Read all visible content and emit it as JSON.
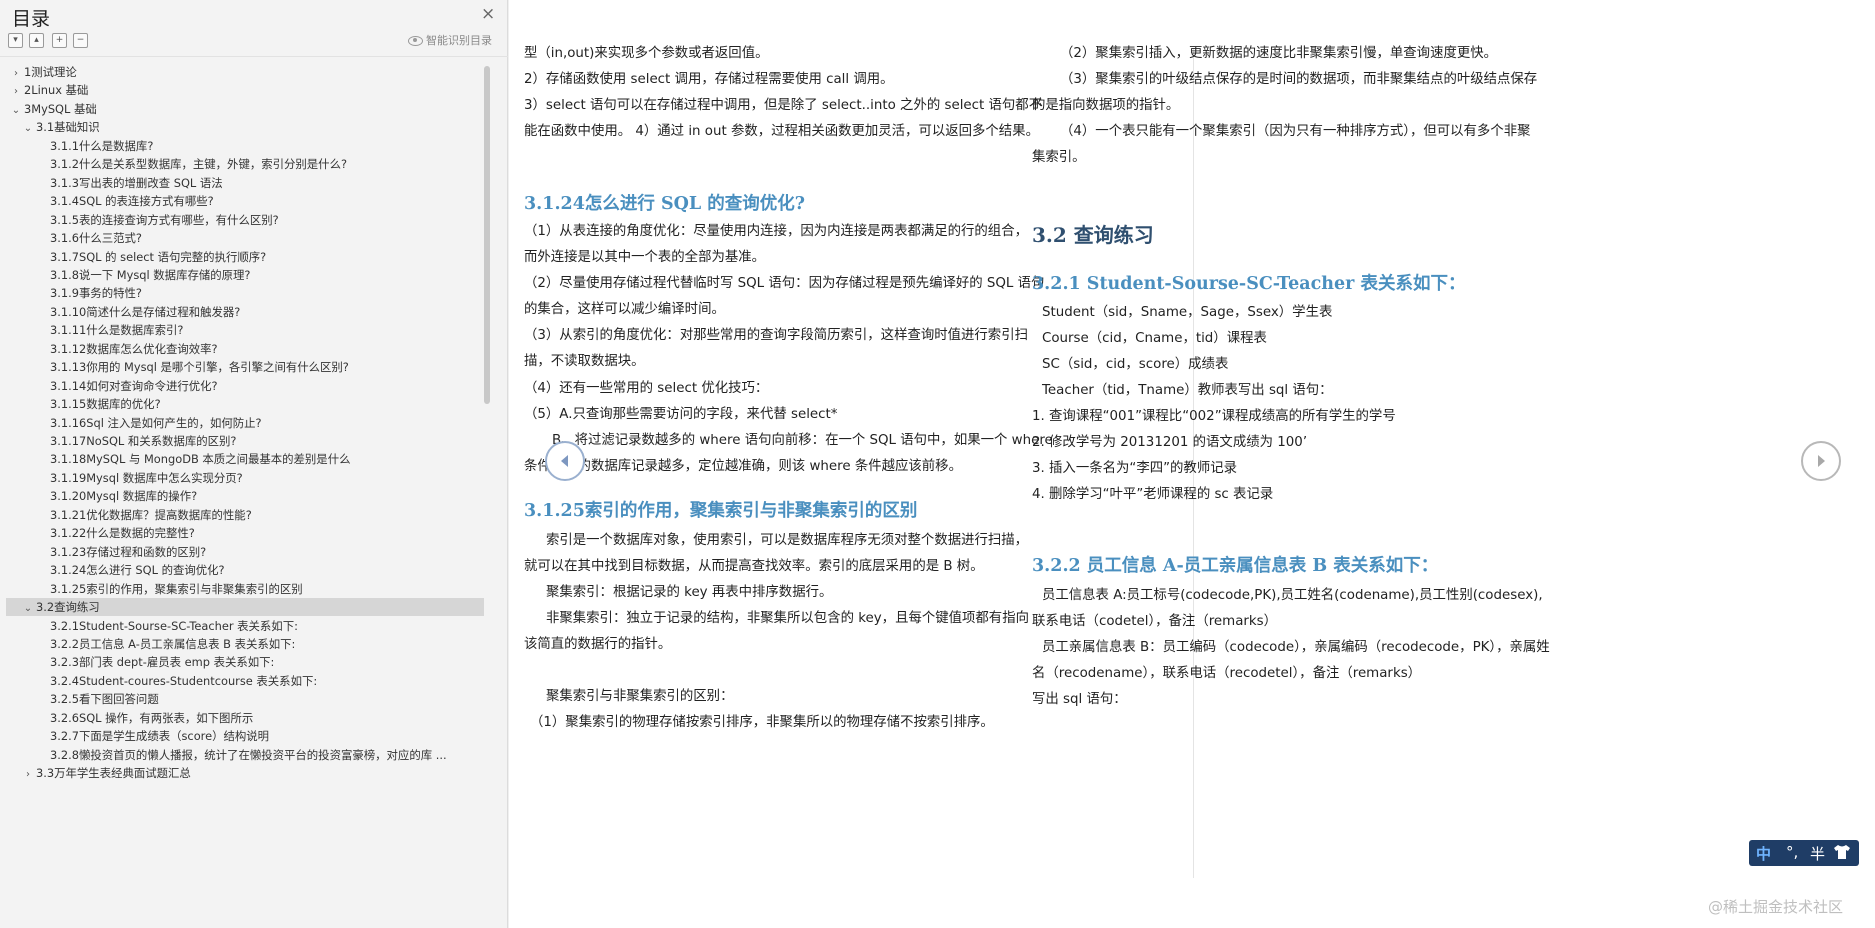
{
  "sidebar": {
    "title": "目录",
    "close_icon": "×",
    "smart_toc_label": "智能识别目录",
    "toolbar": {
      "expand_all": "▾",
      "collapse_all": "▴",
      "add": "+",
      "remove": "−"
    },
    "items": [
      {
        "level": 0,
        "arrow": "›",
        "text": "1测试理论"
      },
      {
        "level": 0,
        "arrow": "›",
        "text": "2Linux 基础"
      },
      {
        "level": 0,
        "arrow": "⌄",
        "text": "3MySQL 基础"
      },
      {
        "level": 1,
        "arrow": "⌄",
        "text": "3.1基础知识"
      },
      {
        "level": 2,
        "arrow": "",
        "text": "3.1.1什么是数据库?"
      },
      {
        "level": 2,
        "arrow": "",
        "text": "3.1.2什么是关系型数据库，主键，外键，索引分别是什么?"
      },
      {
        "level": 2,
        "arrow": "",
        "text": "3.1.3写出表的增删改查 SQL 语法"
      },
      {
        "level": 2,
        "arrow": "",
        "text": "3.1.4SQL 的表连接方式有哪些?"
      },
      {
        "level": 2,
        "arrow": "",
        "text": "3.1.5表的连接查询方式有哪些，有什么区别?"
      },
      {
        "level": 2,
        "arrow": "",
        "text": "3.1.6什么三范式?"
      },
      {
        "level": 2,
        "arrow": "",
        "text": "3.1.7SQL 的 select 语句完整的执行顺序?"
      },
      {
        "level": 2,
        "arrow": "",
        "text": "3.1.8说一下 Mysql 数据库存储的原理?"
      },
      {
        "level": 2,
        "arrow": "",
        "text": "3.1.9事务的特性?"
      },
      {
        "level": 2,
        "arrow": "",
        "text": "3.1.10简述什么是存储过程和触发器?"
      },
      {
        "level": 2,
        "arrow": "",
        "text": "3.1.11什么是数据库索引?"
      },
      {
        "level": 2,
        "arrow": "",
        "text": "3.1.12数据库怎么优化查询效率?"
      },
      {
        "level": 2,
        "arrow": "",
        "text": "3.1.13你用的 Mysql 是哪个引擎，各引擎之间有什么区别?"
      },
      {
        "level": 2,
        "arrow": "",
        "text": "3.1.14如何对查询命令进行优化?"
      },
      {
        "level": 2,
        "arrow": "",
        "text": "3.1.15数据库的优化?"
      },
      {
        "level": 2,
        "arrow": "",
        "text": "3.1.16Sql 注入是如何产生的，如何防止?"
      },
      {
        "level": 2,
        "arrow": "",
        "text": "3.1.17NoSQL 和关系数据库的区别?"
      },
      {
        "level": 2,
        "arrow": "",
        "text": "3.1.18MySQL 与 MongoDB 本质之间最基本的差别是什么"
      },
      {
        "level": 2,
        "arrow": "",
        "text": "3.1.19Mysql 数据库中怎么实现分页?"
      },
      {
        "level": 2,
        "arrow": "",
        "text": "3.1.20Mysql 数据库的操作?"
      },
      {
        "level": 2,
        "arrow": "",
        "text": "3.1.21优化数据库？提高数据库的性能?"
      },
      {
        "level": 2,
        "arrow": "",
        "text": "3.1.22什么是数据的完整性?"
      },
      {
        "level": 2,
        "arrow": "",
        "text": "3.1.23存储过程和函数的区别?"
      },
      {
        "level": 2,
        "arrow": "",
        "text": "3.1.24怎么进行 SQL 的查询优化?"
      },
      {
        "level": 2,
        "arrow": "",
        "text": "3.1.25索引的作用，聚集索引与非聚集索引的区别"
      },
      {
        "level": 1,
        "arrow": "⌄",
        "text": "3.2查询练习",
        "selected": true
      },
      {
        "level": 2,
        "arrow": "",
        "text": "3.2.1Student-Sourse-SC-Teacher 表关系如下:"
      },
      {
        "level": 2,
        "arrow": "",
        "text": "3.2.2员工信息 A-员工亲属信息表 B 表关系如下:"
      },
      {
        "level": 2,
        "arrow": "",
        "text": "3.2.3部门表 dept-雇员表 emp 表关系如下:"
      },
      {
        "level": 2,
        "arrow": "",
        "text": "3.2.4Student-coures-Studentcourse 表关系如下:"
      },
      {
        "level": 2,
        "arrow": "",
        "text": "3.2.5看下图回答问题"
      },
      {
        "level": 2,
        "arrow": "",
        "text": "3.2.6SQL 操作，有两张表，如下图所示"
      },
      {
        "level": 2,
        "arrow": "",
        "text": "3.2.7下面是学生成绩表（score）结构说明"
      },
      {
        "level": 2,
        "arrow": "",
        "text": "3.2.8懒投资首页的懒人播报，统计了在懒投资平台的投资富豪榜，对应的库 ..."
      },
      {
        "level": 1,
        "arrow": "›",
        "text": "3.3万年学生表经典面试题汇总"
      }
    ]
  },
  "left_page": {
    "lines": [
      {
        "kind": "p",
        "text": "型（in,out)来实现多个参数或者返回值。"
      },
      {
        "kind": "p",
        "text": "2）存储函数使用 select 调用，存储过程需要使用 call 调用。"
      },
      {
        "kind": "p",
        "text": "3）select 语句可以在存储过程中调用，但是除了 select..into 之外的 select 语句都不"
      },
      {
        "kind": "p",
        "text": "能在函数中使用。 4）通过 in out 参数，过程相关函数更加灵活，可以返回多个结果。"
      },
      {
        "kind": "h1",
        "text": "3.1.24怎么进行 SQL 的查询优化?"
      },
      {
        "kind": "p",
        "text": "（1）从表连接的角度优化：尽量使用内连接，因为内连接是两表都满足的行的组合，"
      },
      {
        "kind": "p",
        "text": "而外连接是以其中一个表的全部为基准。"
      },
      {
        "kind": "p",
        "text": "（2）尽量使用存储过程代替临时写 SQL 语句：因为存储过程是预先编译好的 SQL 语句"
      },
      {
        "kind": "p",
        "text": "的集合，这样可以减少编译时间。"
      },
      {
        "kind": "p",
        "text": "（3）从索引的角度优化：对那些常用的查询字段简历索引，这样查询时值进行索引扫"
      },
      {
        "kind": "p",
        "text": "描，不读取数据块。"
      },
      {
        "kind": "p",
        "text": "（4）还有一些常用的 select 优化技巧："
      },
      {
        "kind": "p",
        "text": "（5）A.只查询那些需要访问的字段，来代替 select*"
      },
      {
        "kind": "p",
        "text": "B、将过滤记录数越多的 where 语句向前移：在一个 SQL 语句中，如果一个 where"
      },
      {
        "kind": "p",
        "text": "条件过滤的数据库记录越多，定位越准确，则该 where 条件越应该前移。"
      },
      {
        "kind": "h1",
        "text": "3.1.25索引的作用，聚集索引与非聚集索引的区别"
      },
      {
        "kind": "p",
        "text": "索引是一个数据库对象，使用索引，可以是数据库程序无须对整个数据进行扫描，"
      },
      {
        "kind": "p",
        "text": "就可以在其中找到目标数据，从而提高查找效率。索引的底层采用的是 B 树。"
      },
      {
        "kind": "p",
        "text": "聚集索引：根据记录的 key 再表中排序数据行。"
      },
      {
        "kind": "p",
        "text": "非聚集索引：独立于记录的结构，非聚集所以包含的 key，且每个键值项都有指向"
      },
      {
        "kind": "p",
        "text": "该简直的数据行的指针。"
      },
      {
        "kind": "p",
        "text": "聚集索引与非聚集索引的区别："
      },
      {
        "kind": "p",
        "text": "（1）聚集索引的物理存储按索引排序，非聚集所以的物理存储不按索引排序。"
      }
    ]
  },
  "right_page": {
    "lines": [
      {
        "kind": "p",
        "text": "（2）聚集索引插入，更新数据的速度比非聚集索引慢，单查询速度更快。"
      },
      {
        "kind": "p",
        "text": "（3）聚集索引的叶级结点保存的是时间的数据项，而非聚集结点的叶级结点保存"
      },
      {
        "kind": "p",
        "text": "的是指向数据项的指针。"
      },
      {
        "kind": "p",
        "text": "（4）一个表只能有一个聚集索引（因为只有一种排序方式），但可以有多个非聚"
      },
      {
        "kind": "p",
        "text": "集索引。"
      },
      {
        "kind": "h2",
        "text": "3.2 查询练习"
      },
      {
        "kind": "h1",
        "text": "3.2.1 Student-Sourse-SC-Teacher 表关系如下："
      },
      {
        "kind": "p",
        "text": "Student（sid，Sname，Sage，Ssex）学生表"
      },
      {
        "kind": "p",
        "text": "Course（cid，Cname，tid）课程表"
      },
      {
        "kind": "p",
        "text": "SC（sid，cid，score）成绩表"
      },
      {
        "kind": "p",
        "text": "Teacher（tid，Tname）教师表写出 sql 语句："
      },
      {
        "kind": "p",
        "text": "1. 查询课程“001”课程比“002”课程成绩高的所有学生的学号"
      },
      {
        "kind": "p",
        "text": "2. 修改学号为 20131201 的语文成绩为 100’"
      },
      {
        "kind": "p",
        "text": "3. 插入一条名为“李四”的教师记录"
      },
      {
        "kind": "p",
        "text": "4. 删除学习“叶平”老师课程的 sc 表记录"
      },
      {
        "kind": "h1",
        "text": "3.2.2 员工信息 A-员工亲属信息表 B 表关系如下："
      },
      {
        "kind": "p",
        "text": "员工信息表 A:员工标号(codecode,PK),员工姓名(codename),员工性别(codesex),"
      },
      {
        "kind": "p",
        "text": "联系电话（codetel），备注（remarks）"
      },
      {
        "kind": "p",
        "text": "员工亲属信息表 B：员工编码（codecode），亲属编码（recodecode，PK），亲属姓"
      },
      {
        "kind": "p",
        "text": "名（recodename），联系电话（recodetel），备注（remarks）"
      },
      {
        "kind": "p",
        "text": "写出 sql 语句："
      }
    ]
  },
  "ime": {
    "lang": "中",
    "punct": "°,",
    "width": "半",
    "skin_icon": "shirt-icon"
  },
  "watermark": "@稀土掘金技术社区",
  "colors": {
    "heading": "#4a8fbf",
    "section": "#2f4f6f",
    "nav_ring": "#9ab0cf",
    "ime_bg": "#1f3d66"
  }
}
